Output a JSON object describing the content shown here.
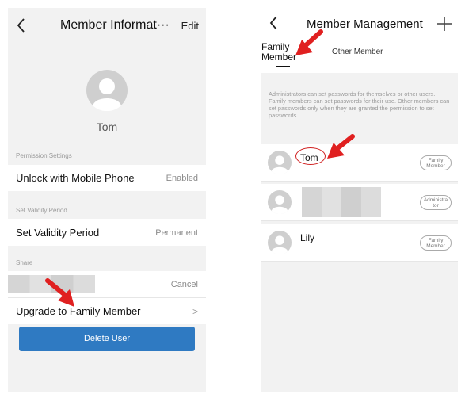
{
  "left": {
    "nav": {
      "back_icon": "chevron-left-icon",
      "title": "Member Informat···",
      "edit_label": "Edit"
    },
    "member_name": "Tom",
    "sections": {
      "permission_settings": "Permission Settings",
      "set_validity_period": "Set Validity Period",
      "share": "Share"
    },
    "rows": {
      "unlock_mobile": {
        "label": "Unlock with Mobile Phone",
        "value": "Enabled"
      },
      "validity": {
        "label": "Set Validity Period",
        "value": "Permanent"
      },
      "share_cancel": "Cancel",
      "upgrade": {
        "label": "Upgrade to Family Member",
        "chevron": ">"
      }
    },
    "delete_button": "Delete User"
  },
  "right": {
    "nav": {
      "back_icon": "chevron-left-icon",
      "title": "Member Management",
      "add_icon": "plus-icon"
    },
    "tabs": {
      "family_line1": "Family",
      "family_line2": "Member",
      "other": "Other Member"
    },
    "info": "Administrators can set passwords for themselves or other users. Family members can set passwords for their use. Other members can set passwords only when they are granted the permission to set passwords.",
    "members": [
      {
        "name": "Tom",
        "badge_line1": "Family",
        "badge_line2": "Member"
      },
      {
        "name": "",
        "badge_line1": "Administra",
        "badge_line2": "tor"
      },
      {
        "name": "Lily",
        "badge_line1": "Family",
        "badge_line2": "Member"
      }
    ]
  },
  "colors": {
    "accent_blue": "#2f7ac2",
    "annotation_red": "#e02020",
    "background": "#f2f2f2"
  }
}
